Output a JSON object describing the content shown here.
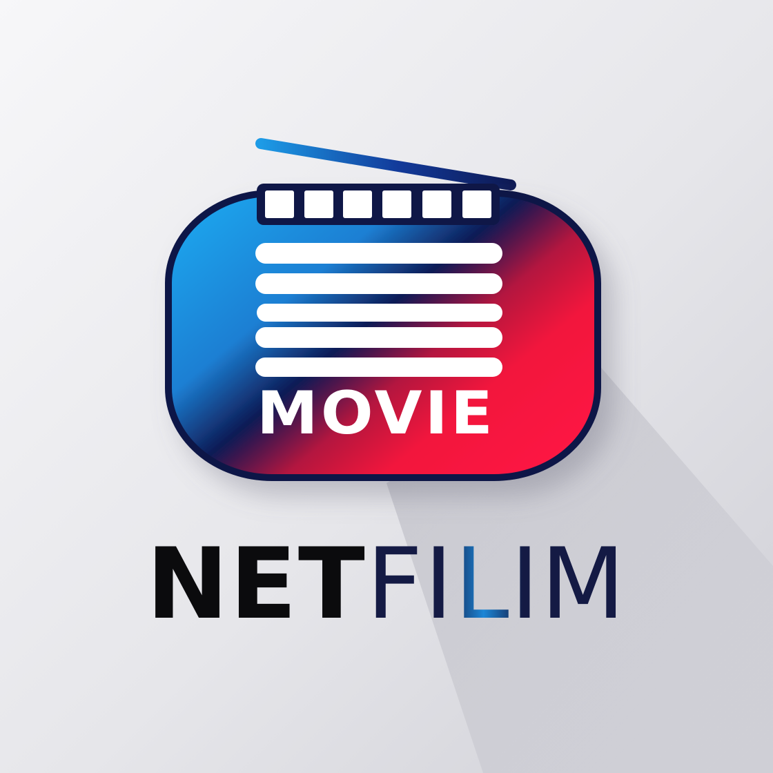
{
  "logo": {
    "badge_text": "MOVIE",
    "wordmark_part_1": "NET",
    "wordmark_part_2": "FILIM"
  },
  "colors": {
    "background_light": "#f5f5f7",
    "background_dark": "#d0d0d7",
    "badge_blue": "#1d9be6",
    "badge_navy": "#0e1a55",
    "badge_red": "#f2123c",
    "outline_navy": "#0f1747",
    "wordmark_black": "#0b0b0d",
    "wordmark_navy": "#141a44",
    "wordmark_accent_blue": "#1c86d6"
  },
  "icons": {
    "badge": "tv-clapperboard-icon",
    "antenna": "antenna-icon",
    "filmstrip": "film-strip-icon"
  }
}
